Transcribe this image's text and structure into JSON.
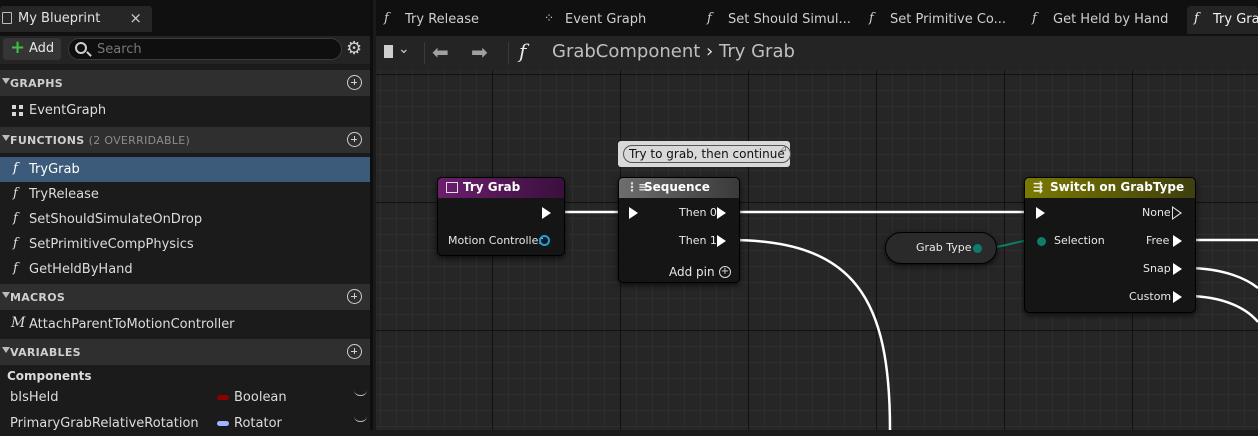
{
  "left_panel": {
    "tab_title": "My Blueprint",
    "tab_close": "×",
    "add_label": "Add",
    "search_placeholder": "Search",
    "sections": {
      "graphs": "GRAPHS",
      "functions": "FUNCTIONS",
      "functions_sub": "(2 OVERRIDABLE)",
      "macros": "MACROS",
      "variables": "VARIABLES"
    },
    "graphs_items": [
      "EventGraph"
    ],
    "function_items": [
      "TryGrab",
      "TryRelease",
      "SetShouldSimulateOnDrop",
      "SetPrimitiveCompPhysics",
      "GetHeldByHand"
    ],
    "macro_items": [
      "AttachParentToMotionController"
    ],
    "components_label": "Components",
    "variables": [
      {
        "name": "bIsHeld",
        "type": "Boolean",
        "color": "#8c0000"
      },
      {
        "name": "PrimaryGrabRelativeRotation",
        "type": "Rotator",
        "color": "#a0b4ff"
      }
    ]
  },
  "tabs": [
    {
      "label": "Try Release",
      "icon": "function-icon"
    },
    {
      "label": "Event Graph",
      "icon": "event-graph-icon"
    },
    {
      "label": "Set Should Simul...",
      "icon": "function-icon"
    },
    {
      "label": "Set Primitive Co...",
      "icon": "function-icon"
    },
    {
      "label": "Get Held by Hand",
      "icon": "function-icon"
    },
    {
      "label": "Try Gra",
      "icon": "function-icon",
      "active": true
    }
  ],
  "breadcrumb": {
    "parent": "GrabComponent",
    "separator": "›",
    "current": "Try Grab"
  },
  "graph": {
    "comment_text": "Try to grab, then continue",
    "try_grab_node": {
      "title": "Try Grab",
      "pin_motion_controller": "Motion Controller"
    },
    "sequence_node": {
      "title": "Sequence",
      "then0": "Then 0",
      "then1": "Then 1",
      "add_pin": "Add pin"
    },
    "grab_type_node": {
      "label": "Grab Type"
    },
    "switch_node": {
      "title": "Switch on GrabType",
      "selection": "Selection",
      "none": "None",
      "free": "Free",
      "snap": "Snap",
      "custom": "Custom"
    }
  },
  "colors": {
    "function_entry_header": "#6b1e6e",
    "sequence_header": "#5c5c5c",
    "switch_header": "#7a7a00",
    "byte_pin": "#0b7d6a",
    "object_pin": "#1b9fe0",
    "selection_bg": "#3c5a7a"
  }
}
